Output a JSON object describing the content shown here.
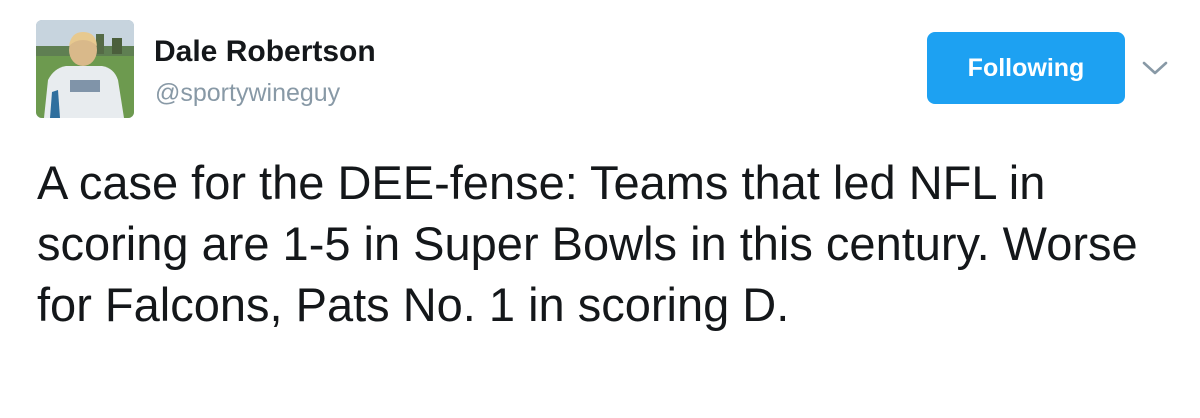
{
  "tweet": {
    "author": {
      "name": "Dale Robertson",
      "handle": "@sportywineguy",
      "avatar_icon": "profile-photo"
    },
    "follow_button_label": "Following",
    "more_options_icon": "chevron-down-icon",
    "text": "A case for the DEE-fense: Teams that led NFL in scoring are 1-5 in Super Bowls in this century. Worse for Falcons, Pats No. 1 in scoring D."
  },
  "colors": {
    "accent": "#1da1f2",
    "text": "#14171a",
    "secondary_text": "#8899a6",
    "caret": "#8899a6",
    "background": "#ffffff"
  }
}
